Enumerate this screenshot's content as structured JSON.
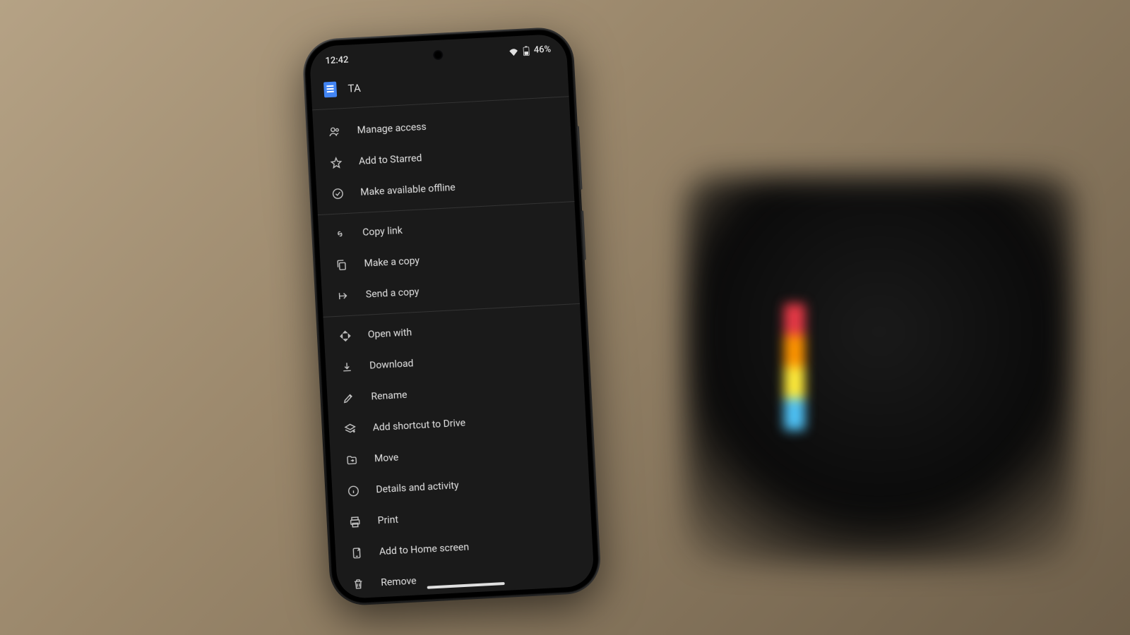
{
  "status": {
    "time": "12:42",
    "battery_pct": "46%"
  },
  "file": {
    "title": "TA"
  },
  "menu": {
    "sections": [
      {
        "items": [
          {
            "label": "Manage access",
            "icon": "people"
          },
          {
            "label": "Add to Starred",
            "icon": "star"
          },
          {
            "label": "Make available offline",
            "icon": "offline"
          }
        ]
      },
      {
        "items": [
          {
            "label": "Copy link",
            "icon": "link"
          },
          {
            "label": "Make a copy",
            "icon": "copy"
          },
          {
            "label": "Send a copy",
            "icon": "send"
          }
        ]
      },
      {
        "items": [
          {
            "label": "Open with",
            "icon": "openwith"
          },
          {
            "label": "Download",
            "icon": "download"
          },
          {
            "label": "Rename",
            "icon": "rename"
          },
          {
            "label": "Add shortcut to Drive",
            "icon": "shortcut"
          },
          {
            "label": "Move",
            "icon": "move"
          },
          {
            "label": "Details and activity",
            "icon": "info"
          },
          {
            "label": "Print",
            "icon": "print"
          },
          {
            "label": "Add to Home screen",
            "icon": "homescreen"
          },
          {
            "label": "Remove",
            "icon": "trash"
          }
        ]
      }
    ]
  }
}
